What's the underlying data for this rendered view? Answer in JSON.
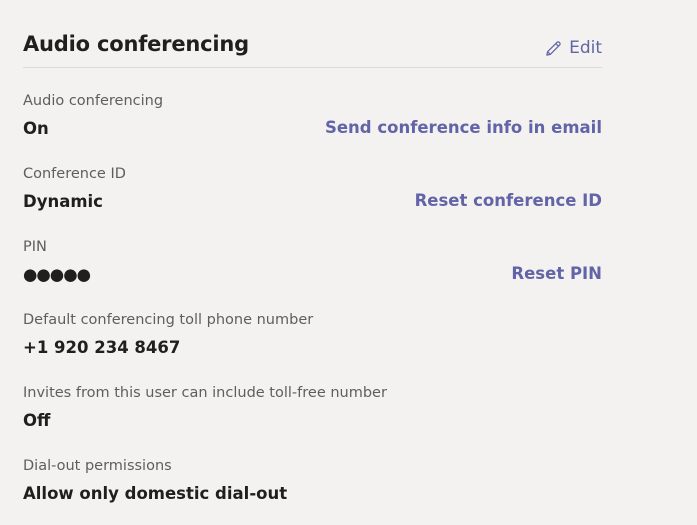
{
  "section": {
    "title": "Audio conferencing",
    "edit_label": "Edit"
  },
  "fields": [
    {
      "label": "Audio conferencing",
      "value": "On",
      "action": "Send conference info in email"
    },
    {
      "label": "Conference ID",
      "value": "Dynamic",
      "action": "Reset conference ID"
    },
    {
      "label": "PIN",
      "value": "●●●●●",
      "action": "Reset PIN"
    },
    {
      "label": "Default conferencing toll phone number",
      "value": "+1 920 234 8467"
    },
    {
      "label": "Invites from this user can include toll-free number",
      "value": "Off"
    },
    {
      "label": "Dial-out permissions",
      "value": "Allow only domestic dial-out"
    }
  ],
  "colors": {
    "background": "#f3f2f1",
    "accent": "#6264a7",
    "text": "#201f1e",
    "label": "#605e5c"
  },
  "icons": {
    "edit": "pencil-icon"
  }
}
